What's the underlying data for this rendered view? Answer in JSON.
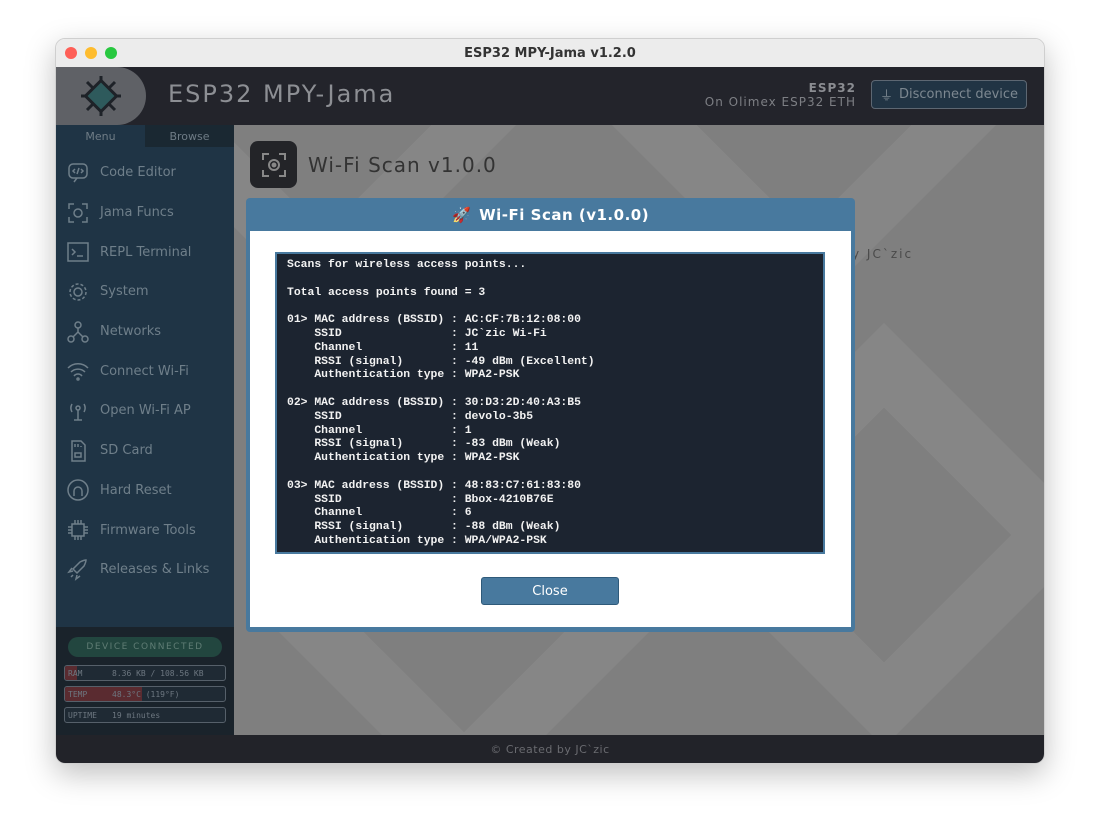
{
  "window": {
    "title": "ESP32 MPY-Jama  v1.2.0"
  },
  "header": {
    "app_title": "ESP32 MPY-Jama",
    "device": "ESP32",
    "board": "On Olimex ESP32 ETH",
    "disconnect_label": "Disconnect device"
  },
  "sidebar": {
    "tabs": [
      "Menu",
      "Browse"
    ],
    "items": [
      {
        "label": "Code Editor",
        "icon": "code-icon"
      },
      {
        "label": "Jama Funcs",
        "icon": "target-icon"
      },
      {
        "label": "REPL Terminal",
        "icon": "terminal-icon"
      },
      {
        "label": "System",
        "icon": "gear-icon"
      },
      {
        "label": "Networks",
        "icon": "network-icon"
      },
      {
        "label": "Connect Wi-Fi",
        "icon": "wifi-icon"
      },
      {
        "label": "Open Wi-Fi AP",
        "icon": "antenna-icon"
      },
      {
        "label": "SD Card",
        "icon": "sd-card-icon"
      },
      {
        "label": "Hard Reset",
        "icon": "power-icon"
      },
      {
        "label": "Firmware Tools",
        "icon": "chip-icon"
      },
      {
        "label": "Releases & Links",
        "icon": "rocket-icon"
      }
    ],
    "status": {
      "connected": "DEVICE CONNECTED",
      "ram_label": "RAM",
      "ram_value": "8.36 KB / 108.56 KB",
      "ram_fraction": 0.077,
      "temp_label": "TEMP",
      "temp_value": "48.3°C (119°F)",
      "temp_fraction": 0.48,
      "uptime_label": "UPTIME",
      "uptime_value": "19 minutes"
    }
  },
  "main": {
    "page_title": "Wi-Fi Scan v1.0.0",
    "author_fragment": "y JC`zic"
  },
  "modal": {
    "title": "Wi-Fi Scan (v1.0.0)",
    "icon": "🚀",
    "close_label": "Close",
    "output": "Scans for wireless access points...\n\nTotal access points found = 3\n\n01> MAC address (BSSID) : AC:CF:7B:12:08:00\n    SSID                : JC`zic Wi-Fi\n    Channel             : 11\n    RSSI (signal)       : -49 dBm (Excellent)\n    Authentication type : WPA2-PSK\n\n02> MAC address (BSSID) : 30:D3:2D:40:A3:B5\n    SSID                : devolo-3b5\n    Channel             : 1\n    RSSI (signal)       : -83 dBm (Weak)\n    Authentication type : WPA2-PSK\n\n03> MAC address (BSSID) : 48:83:C7:61:83:80\n    SSID                : Bbox-4210B76E\n    Channel             : 6\n    RSSI (signal)       : -88 dBm (Weak)\n    Authentication type : WPA/WPA2-PSK"
  },
  "footer": {
    "text": "© Created by JC`zic"
  }
}
